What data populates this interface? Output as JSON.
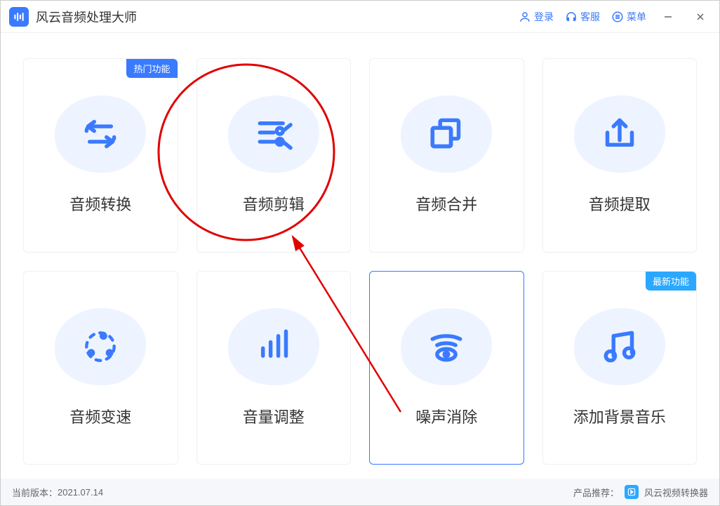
{
  "app": {
    "title": "风云音频处理大师"
  },
  "titlebar": {
    "login": "登录",
    "support": "客服",
    "menu": "菜单"
  },
  "badges": {
    "hot": "热门功能",
    "new": "最新功能"
  },
  "cards": [
    {
      "label": "音频转换"
    },
    {
      "label": "音频剪辑"
    },
    {
      "label": "音频合并"
    },
    {
      "label": "音频提取"
    },
    {
      "label": "音频变速"
    },
    {
      "label": "音量调整"
    },
    {
      "label": "噪声消除"
    },
    {
      "label": "添加背景音乐"
    }
  ],
  "footer": {
    "version_label": "当前版本：",
    "version": "2021.07.14",
    "recommend_label": "产品推荐：",
    "recommend": "风云视频转换器"
  }
}
